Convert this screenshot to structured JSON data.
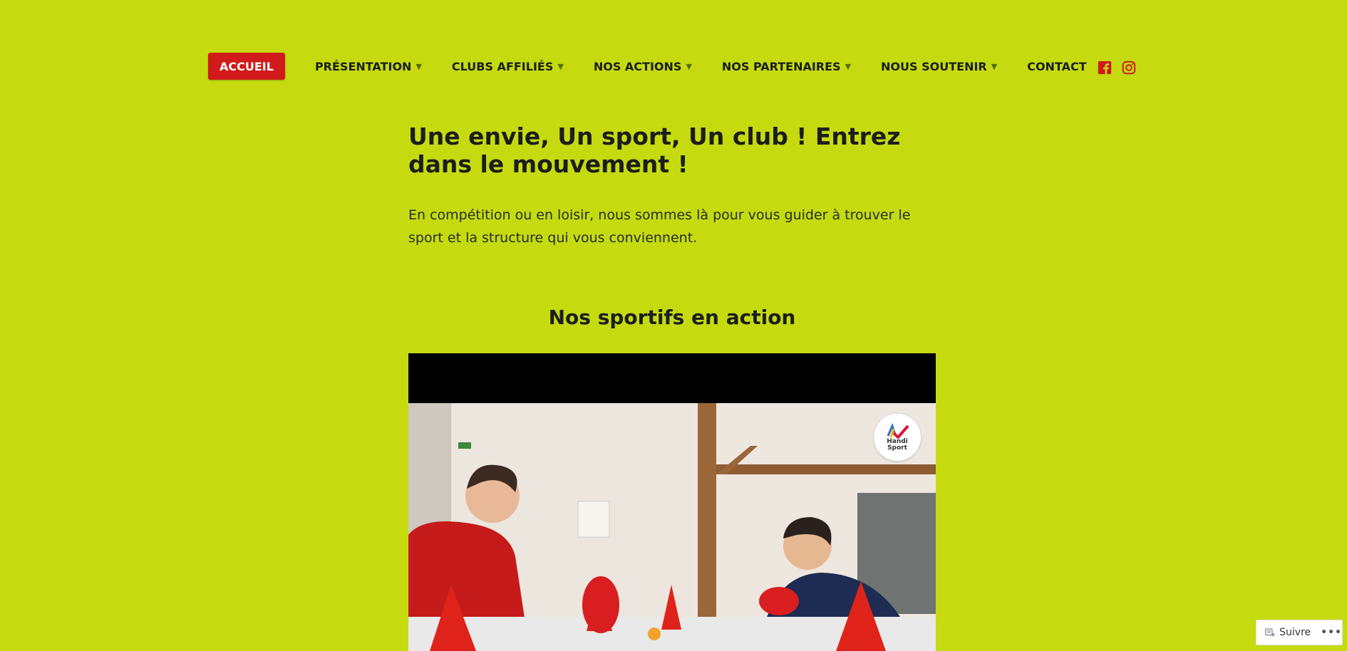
{
  "nav": {
    "items": [
      {
        "label": "ACCUEIL",
        "caret": "",
        "active": true
      },
      {
        "label": "PRÉSENTATION",
        "caret": "▼"
      },
      {
        "label": "CLUBS AFFILIÉS",
        "caret": "▼"
      },
      {
        "label": "NOS ACTIONS",
        "caret": "▼"
      },
      {
        "label": "NOS PARTENAIRES",
        "caret": "▼"
      },
      {
        "label": "NOUS SOUTENIR",
        "caret": "▼"
      },
      {
        "label": "CONTACT",
        "caret": ""
      }
    ]
  },
  "social": {
    "facebook_icon": "facebook-icon",
    "instagram_icon": "instagram-icon",
    "color": "#d11b1b"
  },
  "hero": {
    "title": "Une envie, Un sport, Un club ! Entrez dans le mouvement !",
    "text": "En compétition ou en loisir, nous sommes là pour vous guider à trouver le sport et la structure qui vous conviennent."
  },
  "section": {
    "title": "Nos sportifs en action"
  },
  "video": {
    "logo_text_1": "Handi",
    "logo_text_2": "Sport"
  },
  "follow": {
    "label": "Suivre",
    "more": "•••"
  },
  "colors": {
    "background": "#c5db10",
    "accent": "#d11b1b",
    "text": "#1d1d1d"
  }
}
